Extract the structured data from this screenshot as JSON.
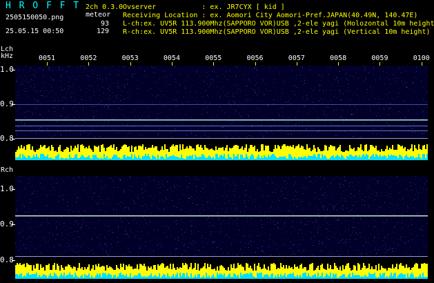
{
  "header": {
    "app_name": "H R O F F T",
    "mode": "2ch 0.3.0",
    "filename": "2505150050.png",
    "datetime": "25.05.15 00:50",
    "counter_label": "meteor",
    "count_l": "93",
    "count_r": "129",
    "observer_line": "Ovserver           : ex. JR7CYX [ kid ]",
    "location_line": "Receiving Location : ex. Aomori City Aomori-Pref.JAPAN(40.49N, 140.47E)",
    "lch_line": "L-ch:ex. UV5R 113.900Mhz(SAPPORO VOR)USB ,2-ele yagi (Holozontal 10m height)",
    "rch_line": "R-ch:ex. UV5R 113.900Mhz(SAPPORO VOR)USB ,2-ele yagi (Vertical 10m height)"
  },
  "upper": {
    "channel_label": "Lch",
    "unit_label": "kHz",
    "y_ticks": [
      "1.0",
      "0.9",
      "0.8"
    ]
  },
  "lower": {
    "channel_label": "Rch",
    "y_ticks": [
      "1.0",
      "0.9",
      "0.8"
    ]
  },
  "time_axis": {
    "labels": [
      "0051",
      "0052",
      "0053",
      "0054",
      "0055",
      "0056",
      "0057",
      "0058",
      "0059",
      "0100"
    ]
  },
  "colors": {
    "background": "#000000",
    "panel": "#000028",
    "label_yellow": "#ffff00",
    "label_cyan": "#00ffff",
    "level_yellow": "#ffff00",
    "level_cyan": "#00e0ff"
  }
}
